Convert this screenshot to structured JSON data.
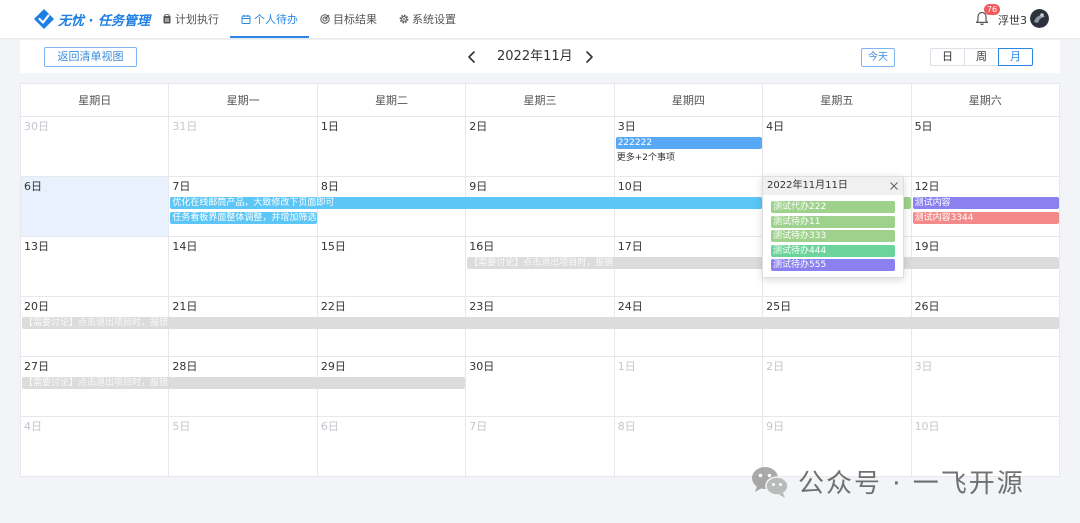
{
  "app": {
    "logo_text": "无忧 · 任务管理",
    "logo_icon": "logo-icon"
  },
  "nav": {
    "items": [
      {
        "label": "计划执行",
        "icon": "clipboard-icon",
        "active": false
      },
      {
        "label": "个人待办",
        "icon": "calendar-icon",
        "active": true
      },
      {
        "label": "目标结果",
        "icon": "target-icon",
        "active": false
      },
      {
        "label": "系统设置",
        "icon": "gear-icon",
        "active": false
      }
    ]
  },
  "user": {
    "name": "浮世3",
    "notification_count": "76",
    "bell_icon": "bell-icon"
  },
  "toolbar": {
    "back_label": "返回清单视图",
    "prev_icon": "chevron-left-icon",
    "title": "2022年11月",
    "next_icon": "chevron-right-icon",
    "today_label": "今天",
    "views": [
      {
        "label": "日",
        "active": false
      },
      {
        "label": "周",
        "active": false
      },
      {
        "label": "月",
        "active": true
      }
    ]
  },
  "calendar": {
    "weekdays": [
      "星期日",
      "星期一",
      "星期二",
      "星期三",
      "星期四",
      "星期五",
      "星期六"
    ],
    "weeks": [
      {
        "days": [
          {
            "label": "30日",
            "muted": true
          },
          {
            "label": "31日",
            "muted": true
          },
          {
            "label": "1日"
          },
          {
            "label": "2日"
          },
          {
            "label": "3日",
            "more": "更多+2个事项"
          },
          {
            "label": "4日"
          },
          {
            "label": "5日"
          }
        ],
        "events": [
          {
            "from": "3日",
            "to": "3日",
            "title": "222222",
            "color": "#58a9f5"
          }
        ]
      },
      {
        "days": [
          {
            "label": "6日",
            "today": true
          },
          {
            "label": "7日"
          },
          {
            "label": "8日"
          },
          {
            "label": "9日"
          },
          {
            "label": "10日"
          },
          {
            "label": "11日"
          },
          {
            "label": "12日"
          }
        ],
        "events": [
          {
            "from": "7日",
            "to": "10日",
            "title": "优化在线邮筒产品，大致修改下页面即可",
            "color": "#5cc6f6"
          },
          {
            "from": "7日",
            "to": "7日",
            "title": "任务看板界面整体调整，并增加筛选的",
            "color": "#5cc6f6"
          },
          {
            "from": "11日",
            "to": "11日",
            "color": "#9ed18c"
          },
          {
            "from": "12日",
            "to": "12日",
            "title": "测试内容",
            "color": "#8b80f0"
          },
          {
            "from": "12日",
            "to": "12日",
            "title": "测试内容3344",
            "color": "#f48989"
          }
        ]
      },
      {
        "days": [
          {
            "label": "13日"
          },
          {
            "label": "14日"
          },
          {
            "label": "15日"
          },
          {
            "label": "16日"
          },
          {
            "label": "17日"
          },
          {
            "label": "18日"
          },
          {
            "label": "19日"
          }
        ],
        "events": [
          {
            "from": "16日",
            "to": "19日",
            "title": "【需要讨论】点击退出项目时，报错",
            "color": "#dcdcdc",
            "text_color": "#f9f9f9"
          }
        ]
      },
      {
        "days": [
          {
            "label": "20日"
          },
          {
            "label": "21日"
          },
          {
            "label": "22日"
          },
          {
            "label": "23日"
          },
          {
            "label": "24日"
          },
          {
            "label": "25日"
          },
          {
            "label": "26日"
          }
        ],
        "events": [
          {
            "from": "20日",
            "to": "26日",
            "title": "【需要讨论】点击退出项目时，报错",
            "color": "#dcdcdc",
            "text_color": "#f9f9f9"
          }
        ]
      },
      {
        "days": [
          {
            "label": "27日"
          },
          {
            "label": "28日"
          },
          {
            "label": "29日"
          },
          {
            "label": "30日"
          },
          {
            "label": "1日",
            "muted": true
          },
          {
            "label": "2日",
            "muted": true
          },
          {
            "label": "3日",
            "muted": true
          }
        ],
        "events": [
          {
            "from": "27日",
            "to": "29日",
            "title": "【需要讨论】点击退出项目时，报错",
            "color": "#dcdcdc",
            "text_color": "#f9f9f9"
          }
        ]
      },
      {
        "days": [
          {
            "label": "4日",
            "muted": true
          },
          {
            "label": "5日",
            "muted": true
          },
          {
            "label": "6日",
            "muted": true
          },
          {
            "label": "7日",
            "muted": true
          },
          {
            "label": "8日",
            "muted": true
          },
          {
            "label": "9日",
            "muted": true
          },
          {
            "label": "10日",
            "muted": true
          }
        ],
        "events": []
      }
    ]
  },
  "popover": {
    "date": "2022年11月11日",
    "close_icon": "close-icon",
    "items": [
      {
        "title": "测试代办222",
        "color": "#9ed18c"
      },
      {
        "title": "测试待办11",
        "color": "#9ed18c"
      },
      {
        "title": "测试待办333",
        "color": "#9ed18c"
      },
      {
        "title": "测试待办444",
        "color": "#6cd49a"
      },
      {
        "title": "测试待办555",
        "color": "#8b80f0"
      }
    ]
  },
  "watermark": {
    "icon": "wechat-icon",
    "text": "公众号 · 一飞开源"
  },
  "colors": {
    "accent": "#2a87e6",
    "today_background": "#e8f1fd",
    "muted_day_text": "#c4c7cc",
    "notification_badge": "#f25b5b"
  }
}
